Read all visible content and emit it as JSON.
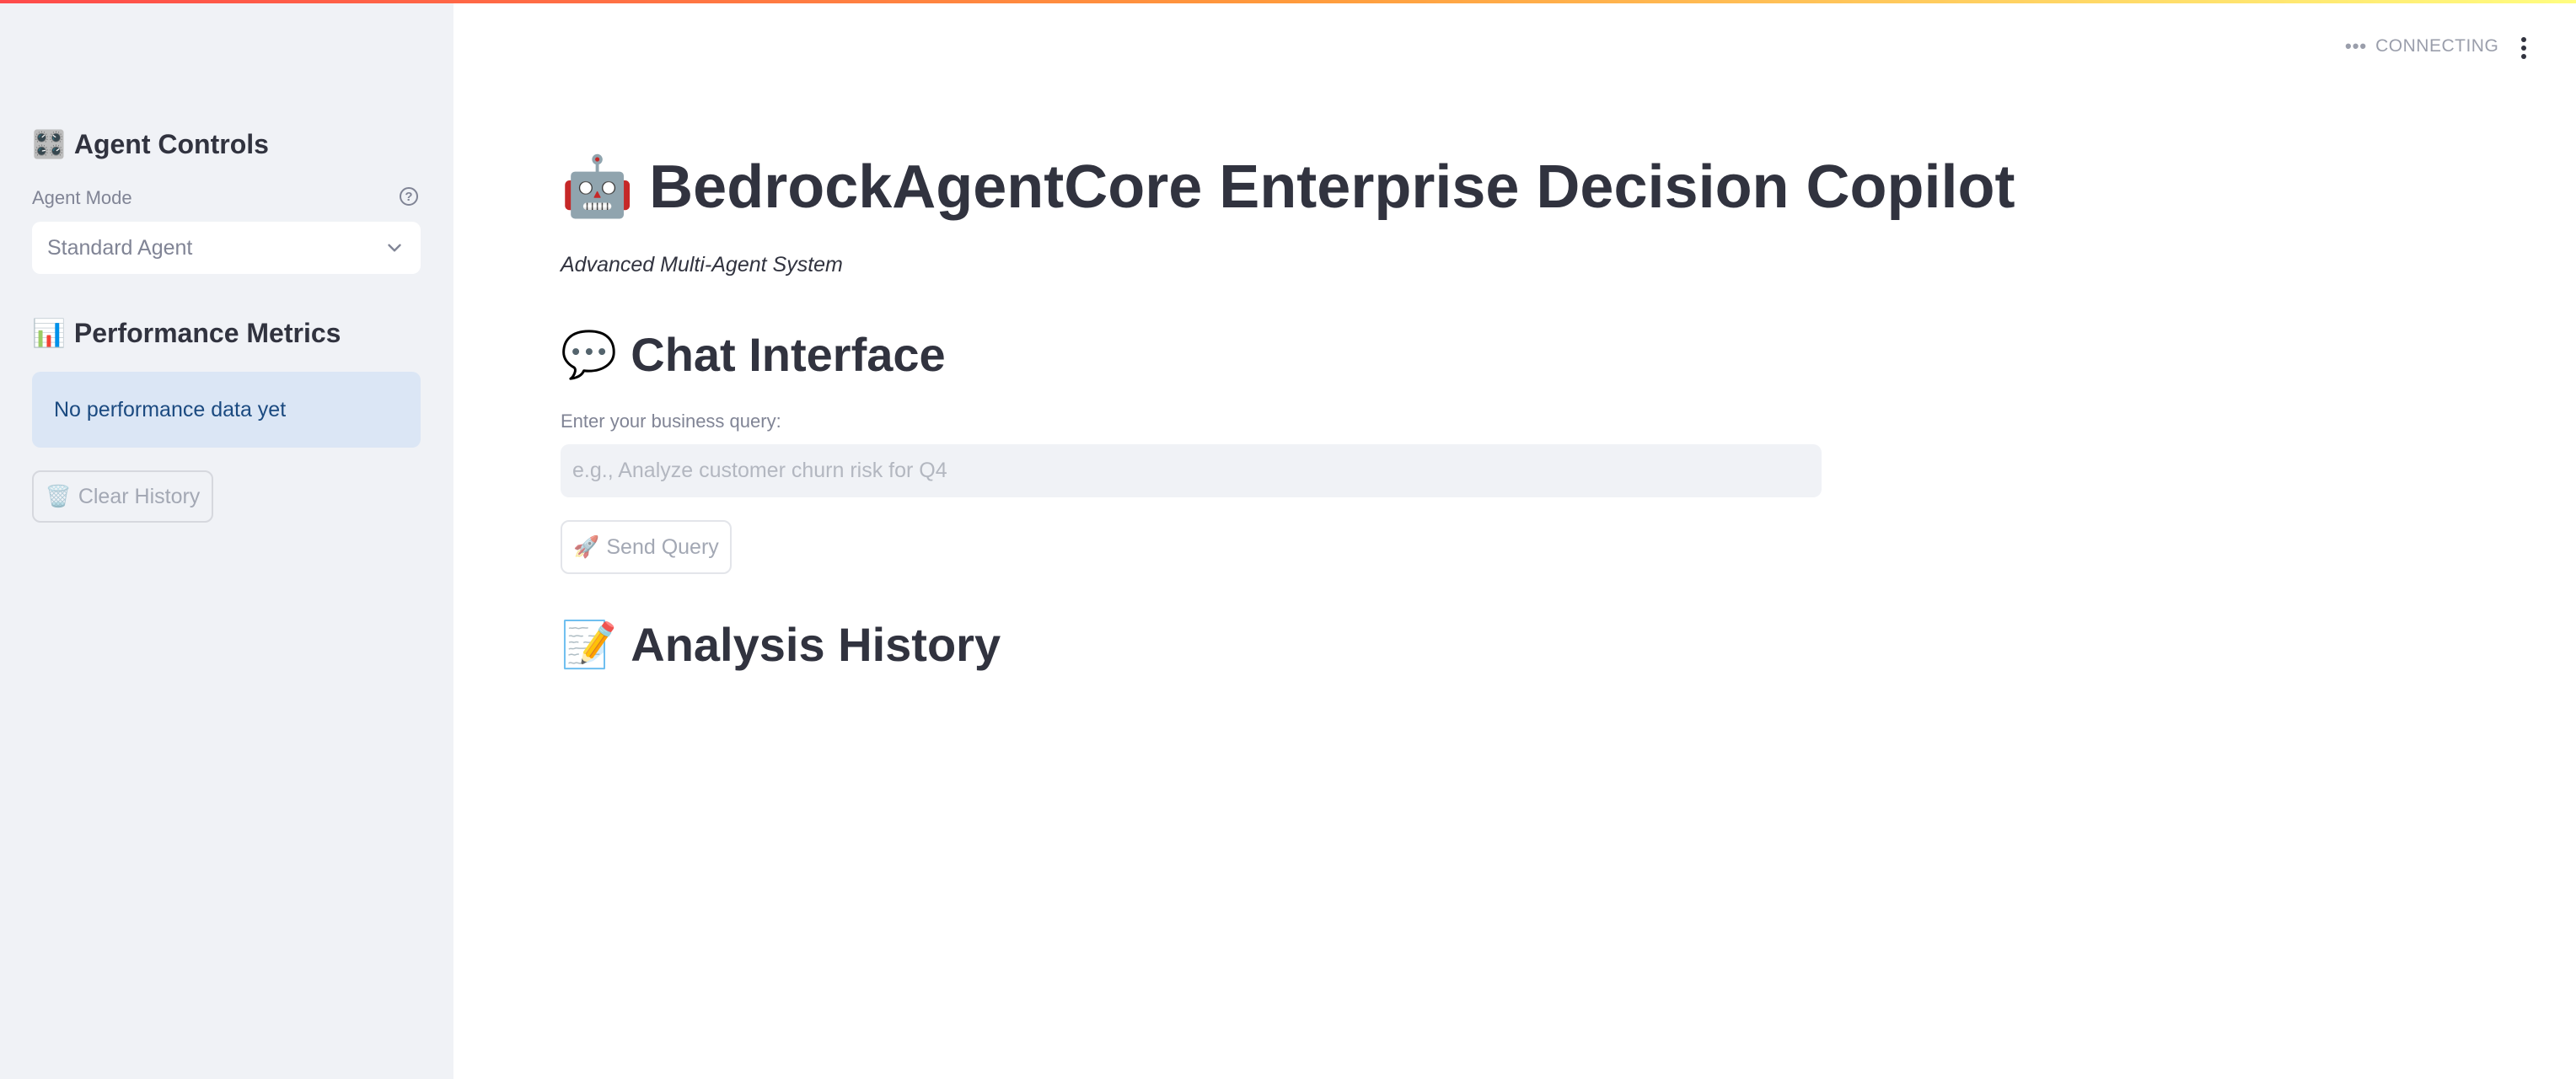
{
  "sidebar": {
    "agent_controls": {
      "icon": "control-knobs-icon",
      "emoji": "🎛️",
      "title": "Agent Controls"
    },
    "agent_mode": {
      "label": "Agent Mode",
      "help_icon": "help-circle-icon",
      "help_glyph": "?",
      "selected": "Standard Agent",
      "chevron_icon": "chevron-down-icon"
    },
    "performance": {
      "icon": "bar-chart-icon",
      "emoji": "📊",
      "title": "Performance Metrics",
      "info_text": "No performance data yet"
    },
    "clear_button": {
      "icon": "wastebasket-icon",
      "emoji": "🗑️",
      "label": "Clear History"
    }
  },
  "header": {
    "status_dots": "•••",
    "status_text": "CONNECTING",
    "menu_icon": "kebab-menu-icon"
  },
  "main": {
    "title": {
      "icon": "robot-icon",
      "emoji": "🤖",
      "text": "BedrockAgentCore Enterprise Decision Copilot"
    },
    "subtitle": "Advanced Multi-Agent System",
    "chat": {
      "icon": "speech-bubble-icon",
      "emoji": "💬",
      "heading": "Chat Interface",
      "input_label": "Enter your business query:",
      "input_placeholder": "e.g., Analyze customer churn risk for Q4",
      "input_value": "",
      "send_button": {
        "icon": "rocket-icon",
        "emoji": "🚀",
        "label": "Send Query"
      }
    },
    "history": {
      "icon": "memo-icon",
      "emoji": "📝",
      "heading": "Analysis History"
    }
  },
  "colors": {
    "accent_gradient": [
      "#ff4b4b",
      "#fffd80"
    ],
    "sidebar_bg": "#f0f2f6",
    "info_bg": "#dbe6f5",
    "info_text": "#1b4a80",
    "text": "#31333f"
  }
}
